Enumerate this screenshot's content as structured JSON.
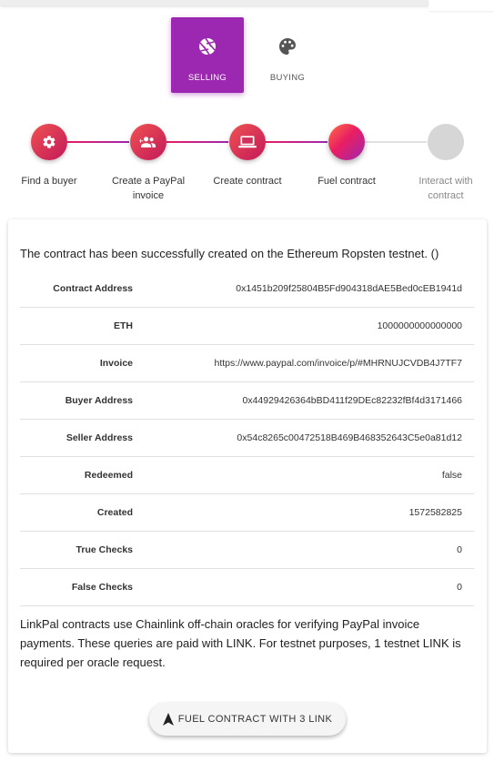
{
  "tabs": [
    {
      "label": "SELLING",
      "icon": "aperture-icon",
      "active": true
    },
    {
      "label": "BUYING",
      "icon": "palette-icon",
      "active": false
    }
  ],
  "steps": [
    {
      "label": "Find a buyer",
      "icon": "gear-icon",
      "state": "done"
    },
    {
      "label": "Create a PayPal invoice",
      "icon": "people-icon",
      "state": "done"
    },
    {
      "label": "Create contract",
      "icon": "laptop-icon",
      "state": "done"
    },
    {
      "label": "Fuel contract",
      "icon": "",
      "state": "current"
    },
    {
      "label": "Interact with contract",
      "icon": "",
      "state": "pending"
    }
  ],
  "message": "The contract has been successfully created on the Ethereum Ropsten testnet. ()",
  "details": [
    {
      "key": "Contract Address",
      "value": "0x1451b209f25804B5Fd904318dAE5Bed0cEB1941d"
    },
    {
      "key": "ETH",
      "value": "1000000000000000"
    },
    {
      "key": "Invoice",
      "value": "https://www.paypal.com/invoice/p/#MHRNUJCVDB4J7TF7"
    },
    {
      "key": "Buyer Address",
      "value": "0x44929426364bBD411f29DEc82232fBf4d3171466"
    },
    {
      "key": "Seller Address",
      "value": "0x54c8265c00472518B469B468352643C5e0a81d12"
    },
    {
      "key": "Redeemed",
      "value": "false"
    },
    {
      "key": "Created",
      "value": "1572582825"
    },
    {
      "key": "True Checks",
      "value": "0"
    },
    {
      "key": "False Checks",
      "value": "0"
    }
  ],
  "note": "LinkPal contracts use Chainlink off-chain oracles for verifying PayPal invoice payments. These queries are paid with LINK. For testnet purposes, 1 testnet LINK is required per oracle request.",
  "fuel_button": {
    "label": "FUEL CONTRACT WITH 3 LINK",
    "icon": "navigation-arrow-icon"
  },
  "colors": {
    "primary": "#9c27b0",
    "accent": "#e91e63",
    "pending": "#d6d6d6"
  }
}
